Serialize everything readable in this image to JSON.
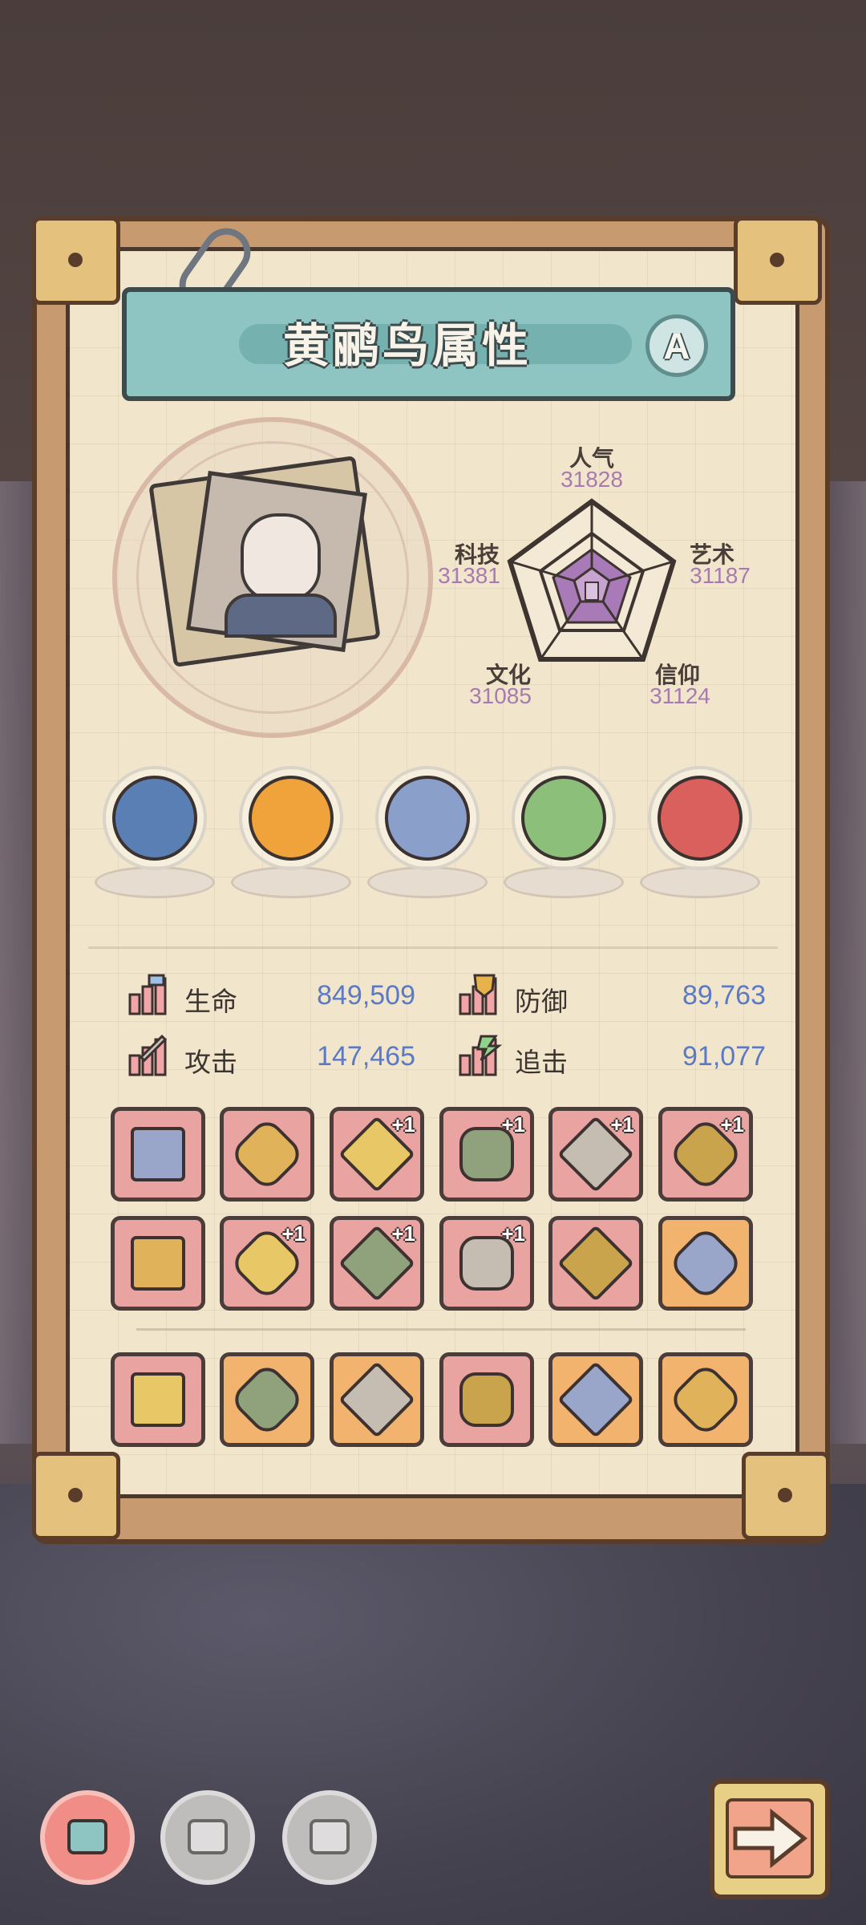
{
  "title": "黄鹂鸟属性",
  "grade": "A",
  "radar": {
    "popularity": {
      "label": "人气",
      "value": "31828"
    },
    "art": {
      "label": "艺术",
      "value": "31187"
    },
    "faith": {
      "label": "信仰",
      "value": "31124"
    },
    "culture": {
      "label": "文化",
      "value": "31085"
    },
    "tech": {
      "label": "科技",
      "value": "31381"
    }
  },
  "relics": [
    {
      "name": "serpent-relic-icon",
      "color": "#5a7fb5"
    },
    {
      "name": "chrysanthemum-icon",
      "color": "#f0a33a"
    },
    {
      "name": "compass-icon",
      "color": "#8a9fc9"
    },
    {
      "name": "jade-torch-icon",
      "color": "#8cbf7a"
    },
    {
      "name": "red-orb-icon",
      "color": "#d9605d"
    }
  ],
  "stats": {
    "hp": {
      "label": "生命",
      "value": "849,509"
    },
    "def": {
      "label": "防御",
      "value": "89,763"
    },
    "atk": {
      "label": "攻击",
      "value": "147,465"
    },
    "chase": {
      "label": "追击",
      "value": "91,077"
    }
  },
  "equipment_row1": [
    {
      "icon": "crystal-gauntlet-icon",
      "color": "red",
      "plus": ""
    },
    {
      "icon": "golden-orb-icon",
      "color": "red",
      "plus": ""
    },
    {
      "icon": "gold-armor-icon",
      "color": "red",
      "plus": "+1"
    },
    {
      "icon": "war-hammer-icon",
      "color": "red",
      "plus": "+1"
    },
    {
      "icon": "dagger-icon",
      "color": "red",
      "plus": "+1"
    },
    {
      "icon": "trumpet-icon",
      "color": "red",
      "plus": "+1"
    }
  ],
  "equipment_row2": [
    {
      "icon": "broadsword-icon",
      "color": "red",
      "plus": ""
    },
    {
      "icon": "ring-icon",
      "color": "red",
      "plus": "+1"
    },
    {
      "icon": "serpent-staff-icon",
      "color": "red",
      "plus": "+1"
    },
    {
      "icon": "lantern-icon",
      "color": "red",
      "plus": "+1"
    },
    {
      "icon": "knife-icon",
      "color": "red",
      "plus": ""
    },
    {
      "icon": "sun-scepter-icon",
      "color": "orange",
      "plus": ""
    }
  ],
  "equipment_row3": [
    {
      "icon": "helmet-icon",
      "color": "red",
      "plus": ""
    },
    {
      "icon": "boot-icon",
      "color": "orange",
      "plus": ""
    },
    {
      "icon": "spear-icon",
      "color": "orange",
      "plus": ""
    },
    {
      "icon": "axe-icon",
      "color": "red",
      "plus": ""
    },
    {
      "icon": "jester-icon",
      "color": "orange",
      "plus": ""
    },
    {
      "icon": "hook-icon",
      "color": "orange",
      "plus": ""
    }
  ],
  "bottom_nav": [
    "map-tab-active",
    "map-tab-2",
    "map-tab-3"
  ],
  "colors": {
    "accent_teal": "#8ec5c3",
    "value_blue": "#5b79c4",
    "radar_purple": "#a77ab0"
  }
}
